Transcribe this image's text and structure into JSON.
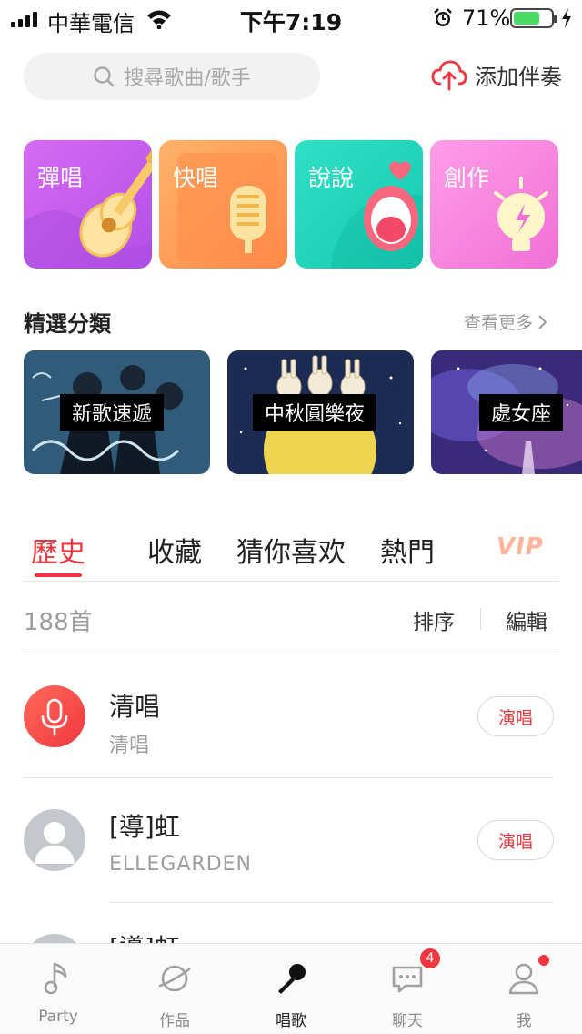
{
  "status_bar": {
    "carrier": "中華電信",
    "time": "下午7:19",
    "battery_percent": "71%",
    "battery_level": 0.71,
    "icons": [
      "signal-icon",
      "wifi-icon",
      "alarm-icon",
      "battery-icon",
      "charging-icon"
    ]
  },
  "search": {
    "placeholder": "搜尋歌曲/歌手",
    "icon": "search-icon"
  },
  "add_accompaniment": {
    "label": "添加伴奏",
    "icon": "cloud-upload-icon"
  },
  "quick_tiles": [
    {
      "label": "彈唱",
      "icon": "guitar-icon",
      "color": "#c95cf0"
    },
    {
      "label": "快唱",
      "icon": "microphone-icon",
      "color": "#ff9a55"
    },
    {
      "label": "說說",
      "icon": "mouth-icon",
      "color": "#20d6bb"
    },
    {
      "label": "創作",
      "icon": "lightbulb-icon",
      "color": "#f884e0"
    }
  ],
  "featured": {
    "title": "精選分類",
    "see_more": "查看更多",
    "cards": [
      {
        "label": "新歌速遞"
      },
      {
        "label": "中秋圓樂夜"
      },
      {
        "label": "處女座"
      }
    ]
  },
  "tabs": {
    "items": [
      "歷史",
      "收藏",
      "猜你喜欢",
      "熱門"
    ],
    "active_index": 0,
    "vip": "VIP",
    "accent": "#f0373f"
  },
  "list_header": {
    "count": "188首",
    "sort": "排序",
    "edit": "編輯"
  },
  "songs": [
    {
      "title": "清唱",
      "subtitle": "清唱",
      "action": "演唱",
      "avatar": "microphone-icon"
    },
    {
      "title": "[導]虹",
      "subtitle": "ELLEGARDEN",
      "action": "演唱",
      "avatar": "user-placeholder-icon"
    },
    {
      "title": "[導]虹",
      "subtitle": "",
      "action": "",
      "avatar": "user-placeholder-icon"
    }
  ],
  "bottom_nav": {
    "items": [
      {
        "label": "Party",
        "icon": "music-note-icon"
      },
      {
        "label": "作品",
        "icon": "planet-icon"
      },
      {
        "label": "唱歌",
        "icon": "microphone-icon"
      },
      {
        "label": "聊天",
        "icon": "chat-bubble-icon"
      },
      {
        "label": "我",
        "icon": "profile-icon"
      }
    ],
    "active_index": 2,
    "chat_badge": "4"
  }
}
